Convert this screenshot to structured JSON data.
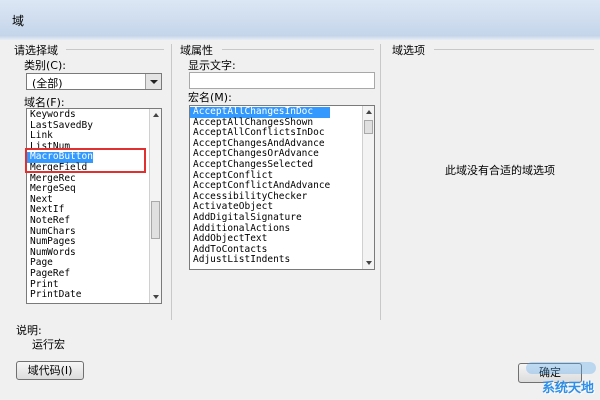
{
  "window": {
    "title": "域"
  },
  "left_section": {
    "title": "请选择域",
    "category_label": "类别(C):",
    "category_value": "(全部)",
    "fieldnames_label": "域名(F):",
    "fieldnames": [
      "Keywords",
      "LastSavedBy",
      "Link",
      "ListNum",
      "MacroButton",
      "MergeField",
      "MergeRec",
      "MergeSeq",
      "Next",
      "NextIf",
      "NoteRef",
      "NumChars",
      "NumPages",
      "NumWords",
      "Page",
      "PageRef",
      "Print",
      "PrintDate"
    ],
    "selected_fieldname": "MacroButton"
  },
  "mid_section": {
    "title": "域属性",
    "display_text_label": "显示文字:",
    "display_text_value": "",
    "macro_label": "宏名(M):",
    "macros": [
      "AcceptAllChangesInDoc",
      "AcceptAllChangesShown",
      "AcceptAllConflictsInDoc",
      "AcceptChangesAndAdvance",
      "AcceptChangesOrAdvance",
      "AcceptChangesSelected",
      "AcceptConflict",
      "AcceptConflictAndAdvance",
      "AccessibilityChecker",
      "ActivateObject",
      "AddDigitalSignature",
      "AdditionalActions",
      "AddObjectText",
      "AddToContacts",
      "AdjustListIndents"
    ],
    "selected_macro": "AcceptAllChangesInDoc"
  },
  "right_section": {
    "title": "域选项",
    "empty_message": "此域没有合适的域选项"
  },
  "description": {
    "label": "说明:",
    "text": "运行宏"
  },
  "buttons": {
    "field_codes": "域代码(I)",
    "ok": "确定"
  },
  "watermark": {
    "text": "系统天地"
  },
  "colors": {
    "selection": "#3399ff",
    "highlight": "#e03030"
  }
}
